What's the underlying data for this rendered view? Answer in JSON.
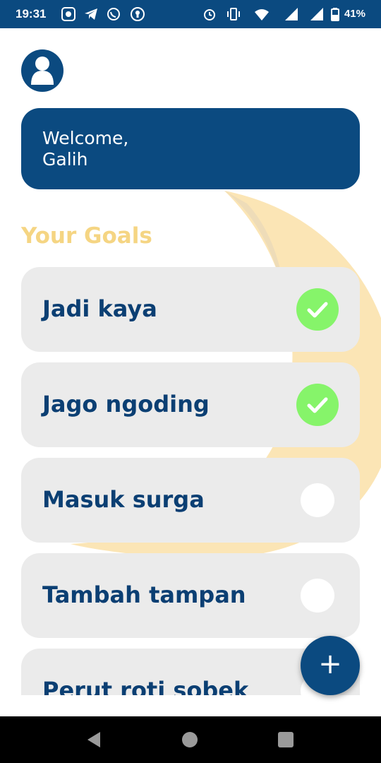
{
  "status_bar": {
    "time": "19:31",
    "battery": "41%",
    "icons": [
      "dot-icon",
      "telegram-icon",
      "whatsapp-icon",
      "lock-icon",
      "alarm-icon",
      "vibrate-icon",
      "wifi-icon",
      "signal-icon",
      "signal-icon",
      "battery-icon"
    ]
  },
  "profile": {
    "icon": "user-icon"
  },
  "welcome": {
    "line1": "Welcome,",
    "line2": "Galih"
  },
  "goals_title": "Your Goals",
  "goals": [
    {
      "label": "Jadi kaya",
      "done": true
    },
    {
      "label": "Jago ngoding",
      "done": true
    },
    {
      "label": "Masuk surga",
      "done": false
    },
    {
      "label": "Tambah tampan",
      "done": false
    },
    {
      "label": "Perut roti sobek",
      "done": false
    }
  ],
  "fab": {
    "label": "+"
  },
  "colors": {
    "primary": "#0b4a80",
    "accent_title": "#f5d583",
    "done": "#86f46a",
    "card": "#ebebeb"
  }
}
